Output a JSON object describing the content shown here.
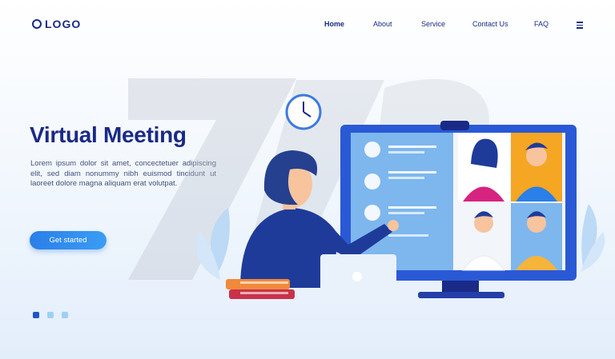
{
  "logo": {
    "text": "LOGO",
    "icon": "ring-icon"
  },
  "nav": {
    "items": [
      {
        "label": "Home",
        "active": true
      },
      {
        "label": "About"
      },
      {
        "label": "Service"
      },
      {
        "label": "Contact Us"
      },
      {
        "label": "FAQ"
      }
    ],
    "menu_icon": "hamburger-icon"
  },
  "hero": {
    "title": "Virtual Meeting",
    "body": "Lorem ipsum dolor sit amet, concectetuer adipiscing elit, sed diam nonummy nibh euismod tincidunt ut laoreet dolore magna aliquam erat volutpat.",
    "cta_label": "Get started"
  },
  "carousel": {
    "count": 3,
    "active_index": 0
  },
  "colors": {
    "brand": "#1a2a86",
    "accent": "#2a7fe8",
    "dot_inactive": "#9dd0f7"
  }
}
